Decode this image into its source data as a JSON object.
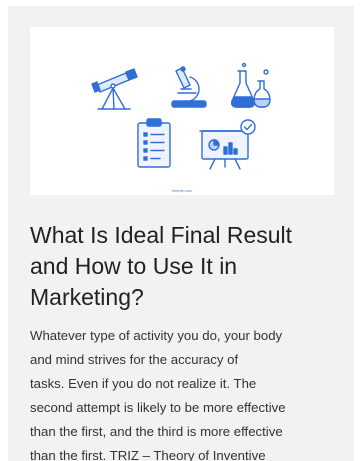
{
  "article": {
    "image": {
      "caption": "freepik.com",
      "icons": [
        "telescope-icon",
        "microscope-icon",
        "flasks-icon",
        "clipboard-icon",
        "presentation-board-icon"
      ],
      "accent_color": "#2f6fd6"
    },
    "title": "What Is Ideal Final Result\nand How to Use It in\nMarketing?",
    "excerpt": "Whatever type of activity you do, your body\nand mind strives for the accuracy of\ntasks. Even if you do not realize it. The\nsecond attempt is likely to be more effective\nthan the first, and the third is more effective\nthan the first. TRIZ – Theory of Inventive"
  }
}
